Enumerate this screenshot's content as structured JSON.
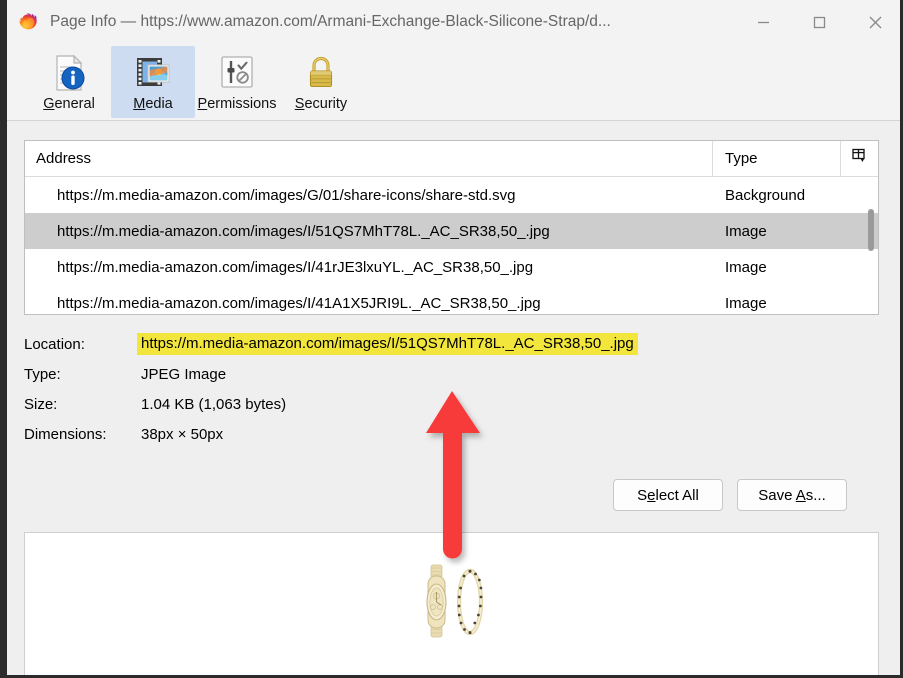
{
  "window": {
    "title": "Page Info — https://www.amazon.com/Armani-Exchange-Black-Silicone-Strap/d...",
    "app_icon": "firefox-logo-icon",
    "controls": {
      "minimize": "minimize-icon",
      "maximize": "maximize-icon",
      "close": "close-icon"
    }
  },
  "toolbar": {
    "tabs": [
      {
        "id": "general",
        "label_pre": "",
        "label_accel": "G",
        "label_post": "eneral",
        "icon": "document-info-icon",
        "selected": false
      },
      {
        "id": "media",
        "label_pre": "",
        "label_accel": "M",
        "label_post": "edia",
        "icon": "media-image-icon",
        "selected": true
      },
      {
        "id": "permissions",
        "label_pre": "",
        "label_accel": "P",
        "label_post": "ermissions",
        "icon": "sliders-check-icon",
        "selected": false
      },
      {
        "id": "security",
        "label_pre": "",
        "label_accel": "S",
        "label_post": "ecurity",
        "icon": "padlock-icon",
        "selected": false
      }
    ]
  },
  "media_list": {
    "columns": [
      "Address",
      "Type"
    ],
    "column_picker_icon": "column-picker-icon",
    "rows": [
      {
        "address": "https://m.media-amazon.com/images/G/01/share-icons/share-std.svg",
        "type": "Background",
        "selected": false
      },
      {
        "address": "https://m.media-amazon.com/images/I/51QS7MhT78L._AC_SR38,50_.jpg",
        "type": "Image",
        "selected": true
      },
      {
        "address": "https://m.media-amazon.com/images/I/41rJE3lxuYL._AC_SR38,50_.jpg",
        "type": "Image",
        "selected": false
      },
      {
        "address": "https://m.media-amazon.com/images/I/41A1X5JRI9L._AC_SR38,50_.jpg",
        "type": "Image",
        "selected": false
      }
    ],
    "scrollbar": "vertical-scrollbar"
  },
  "details": {
    "fields": [
      {
        "label": "Location:",
        "value": "https://m.media-amazon.com/images/I/51QS7MhT78L._AC_SR38,50_.jpg",
        "highlighted": true
      },
      {
        "label": "Type:",
        "value": "JPEG Image",
        "highlighted": false
      },
      {
        "label": "Size:",
        "value": "1.04 KB (1,063 bytes)",
        "highlighted": false
      },
      {
        "label": "Dimensions:",
        "value": "38px × 50px",
        "highlighted": false
      }
    ]
  },
  "buttons": [
    {
      "id": "select-all",
      "pre": "S",
      "accel": "e",
      "post": "lect All"
    },
    {
      "id": "save-as",
      "pre": "Save ",
      "accel": "A",
      "post": "s..."
    }
  ],
  "preview": {
    "image_alt": "gold watch and bracelet set preview",
    "background": "#ffffff"
  },
  "annotation": {
    "arrow_color": "#f73b3b",
    "arrow_direction": "up",
    "points_at": "Location:"
  },
  "colors": {
    "window_bg": "#efefef",
    "titlebar_bg": "#f3f3f3",
    "tab_selected_bg": "#cddcf0",
    "row_selected_bg": "#cdcdcd",
    "highlight_yellow": "#f2e63c",
    "arrow_red": "#f73b3b",
    "frame_dark": "#2b2b2b"
  }
}
